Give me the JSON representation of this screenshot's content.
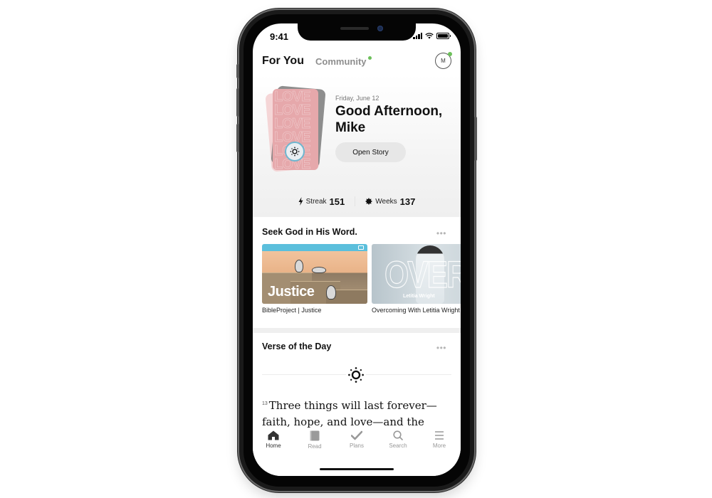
{
  "status_bar": {
    "time": "9:41"
  },
  "top_nav": {
    "tabs": [
      {
        "label": "For You",
        "active": true
      },
      {
        "label": "Community",
        "active": false,
        "has_notification": true
      }
    ],
    "avatar_initial": "M",
    "accent_dot_color": "#6cc05a"
  },
  "hero": {
    "date": "Friday, June 12",
    "greeting": "Good Afternoon, Mike",
    "open_story_label": "Open Story",
    "story_card_text": "LOVE\nLOVE\nLOVE\nLOVE\nLOVE\nLOVE",
    "stats": [
      {
        "icon": "lightning-icon",
        "label": "Streak",
        "value": "151"
      },
      {
        "icon": "badge-icon",
        "label": "Weeks",
        "value": "137"
      }
    ]
  },
  "sections": {
    "seek": {
      "title": "Seek God in His Word.",
      "more_label": "•••",
      "cards": [
        {
          "image_title": "Justice",
          "caption": "BibleProject | Justice"
        },
        {
          "image_title": "OVERCOMING",
          "image_subtitle": "Letitia Wright",
          "caption": "Overcoming With Letitia Wright"
        }
      ]
    },
    "verse_of_day": {
      "title": "Verse of the Day",
      "more_label": "•••",
      "verse_number": "13",
      "verse_text": "Three things will last forever—faith, hope, and love—and the"
    }
  },
  "tab_bar": {
    "items": [
      {
        "label": "Home",
        "icon": "home-icon",
        "active": true
      },
      {
        "label": "Read",
        "icon": "book-icon",
        "active": false
      },
      {
        "label": "Plans",
        "icon": "checkmark-icon",
        "active": false
      },
      {
        "label": "Search",
        "icon": "search-icon",
        "active": false
      },
      {
        "label": "More",
        "icon": "menu-icon",
        "active": false
      }
    ]
  }
}
